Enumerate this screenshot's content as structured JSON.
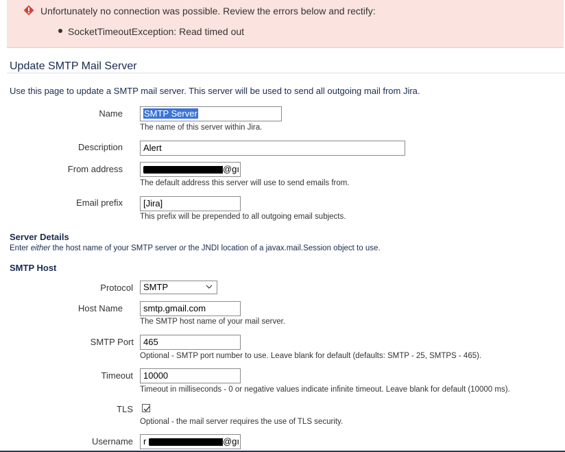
{
  "error": {
    "message": "Unfortunately no connection was possible. Review the errors below and rectify:",
    "items": [
      "SocketTimeoutException: Read timed out"
    ]
  },
  "page": {
    "title": "Update SMTP Mail Server",
    "intro": "Use this page to update a SMTP mail server. This server will be used to send all outgoing mail from Jira."
  },
  "fields": {
    "name": {
      "label": "Name",
      "value": "SMTP Server",
      "description": "The name of this server within Jira."
    },
    "description": {
      "label": "Description",
      "value": "Alert"
    },
    "from_address": {
      "label": "From address",
      "value_visible_suffix": "@gı",
      "description": "The default address this server will use to send emails from."
    },
    "email_prefix": {
      "label": "Email prefix",
      "value": "[Jira]",
      "description": "This prefix will be prepended to all outgoing email subjects."
    }
  },
  "server_details": {
    "heading": "Server Details",
    "sub_pre": "Enter ",
    "sub_either": "either",
    "sub_mid": " the host name of your SMTP server ",
    "sub_or": "or",
    "sub_post": " the JNDI location of a javax.mail.Session object to use."
  },
  "smtp_host": {
    "heading": "SMTP Host",
    "protocol": {
      "label": "Protocol",
      "selected": "SMTP"
    },
    "host_name": {
      "label": "Host Name",
      "value": "smtp.gmail.com",
      "description": "The SMTP host name of your mail server."
    },
    "port": {
      "label": "SMTP Port",
      "value": "465",
      "description": "Optional - SMTP port number to use. Leave blank for default (defaults: SMTP - 25, SMTPS - 465)."
    },
    "timeout": {
      "label": "Timeout",
      "value": "10000",
      "description": "Timeout in milliseconds - 0 or negative values indicate infinite timeout. Leave blank for default (10000 ms)."
    },
    "tls": {
      "label": "TLS",
      "checked": true,
      "description": "Optional - the mail server requires the use of TLS security."
    },
    "username": {
      "label": "Username",
      "value_visible_prefix": "r",
      "value_visible_suffix": "@gı"
    }
  },
  "colors": {
    "error_bg": "#fbe3df",
    "error_icon": "#d04437",
    "selection": "#3b74d6"
  }
}
